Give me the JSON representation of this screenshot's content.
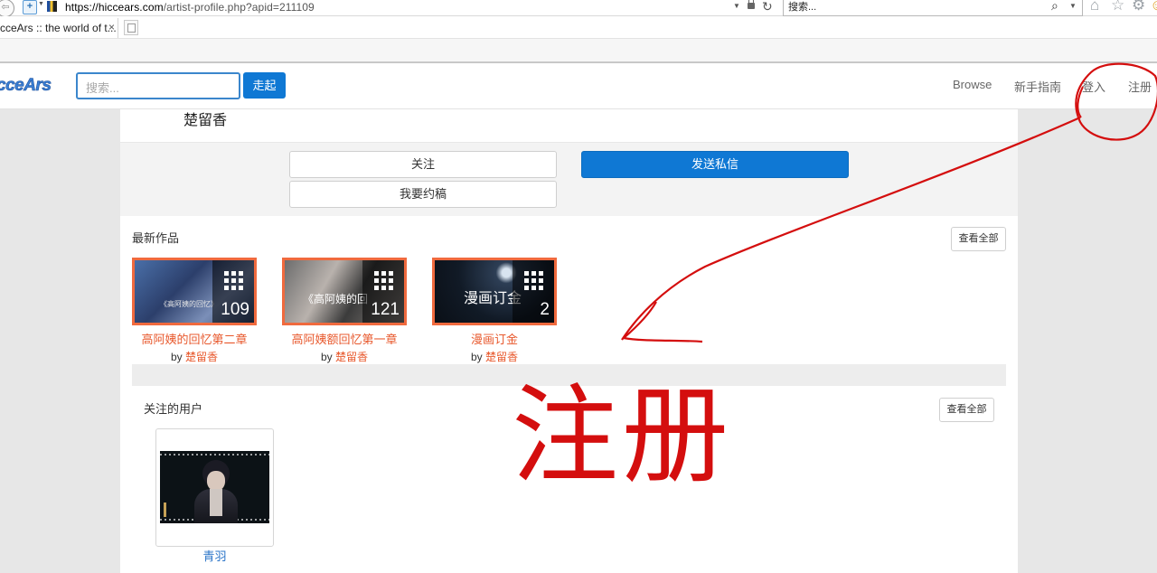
{
  "browser": {
    "url_host": "https://hiccears.com",
    "url_path": "/artist-profile.php?apid=211109",
    "search_placeholder": "搜索...",
    "tab_title": "cceArs :: the world of t...",
    "tab_close": "×",
    "icons": [
      "back-icon",
      "site-identity-icon",
      "lock-icon",
      "refresh-icon",
      "search-icon",
      "home-icon",
      "favorites-star-icon",
      "settings-gear-icon",
      "close-icon"
    ]
  },
  "site": {
    "logo": "cceArs",
    "search_placeholder": "搜索...",
    "go_label": "走起",
    "nav": {
      "browse": "Browse",
      "guide": "新手指南",
      "login": "登入",
      "register": "注册"
    }
  },
  "artist": {
    "name": "楚留香",
    "follow_label": "关注",
    "message_label": "发送私信",
    "commission_label": "我要约稿"
  },
  "latest": {
    "title": "最新作品",
    "view_all": "查看全部",
    "by_label": "by",
    "works": [
      {
        "title": "高阿姨的回忆第二章",
        "author": "楚留香",
        "count": "109",
        "thumb_text": "《高阿姨的回忆》"
      },
      {
        "title": "高阿姨额回忆第一章",
        "author": "楚留香",
        "count": "121",
        "thumb_text": "《高阿姨的回"
      },
      {
        "title": "漫画订金",
        "author": "楚留香",
        "count": "2",
        "thumb_text": "漫画订金"
      }
    ]
  },
  "following": {
    "title": "关注的用户",
    "view_all": "查看全部",
    "users": [
      {
        "name": "青羽"
      }
    ]
  },
  "annotation": {
    "text": "注册",
    "color": "#d40e0e"
  },
  "colors": {
    "primary": "#0f78d4",
    "accent_orange": "#e8582c"
  }
}
